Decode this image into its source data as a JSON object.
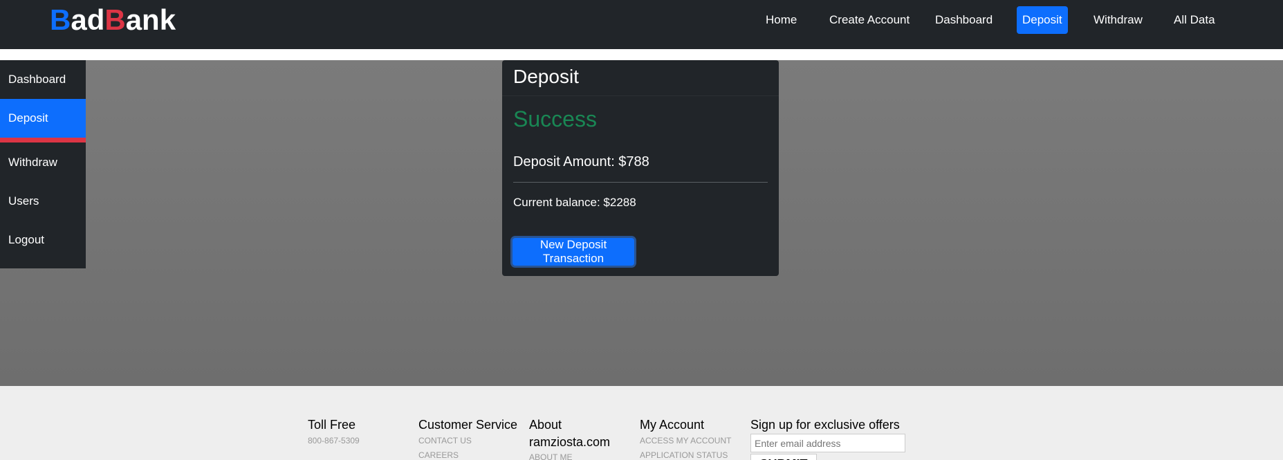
{
  "brand": {
    "b1": "B",
    "ad": "ad",
    "b2": "B",
    "ank": "ank"
  },
  "nav": {
    "items": [
      {
        "label": "Home"
      },
      {
        "label": "Create Account"
      },
      {
        "label": "Dashboard"
      },
      {
        "label": "Deposit"
      },
      {
        "label": "Withdraw"
      },
      {
        "label": "All Data"
      }
    ],
    "active": "Deposit"
  },
  "sidebar": {
    "items": [
      {
        "label": "Dashboard"
      },
      {
        "label": "Deposit"
      },
      {
        "label": "Withdraw"
      },
      {
        "label": "Users"
      },
      {
        "label": "Logout"
      }
    ],
    "active": "Deposit"
  },
  "card": {
    "title": "Deposit",
    "status": "Success",
    "amount_text": "Deposit Amount: $788",
    "balance_text": "Current balance: $2288",
    "button_label": "New Deposit Transaction"
  },
  "footer": {
    "toll_free": {
      "heading": "Toll Free",
      "phone": "800-867-5309"
    },
    "customer_service": {
      "heading": "Customer Service",
      "links": [
        "CONTACT US",
        "CAREERS"
      ]
    },
    "about": {
      "heading": "About ramziosta.com",
      "links": [
        "ABOUT ME"
      ]
    },
    "my_account": {
      "heading": "My Account",
      "links": [
        "ACCESS MY ACCOUNT",
        "APPLICATION STATUS"
      ]
    },
    "signup": {
      "heading": "Sign up for exclusive offers",
      "placeholder": "Enter email address",
      "submit_label": "SUBMIT"
    }
  },
  "colors": {
    "navbar_bg": "#212529",
    "primary": "#0d6efd",
    "danger": "#dc3545",
    "success": "#198754",
    "main_bg": "#777777",
    "footer_bg": "#eeeeee"
  }
}
